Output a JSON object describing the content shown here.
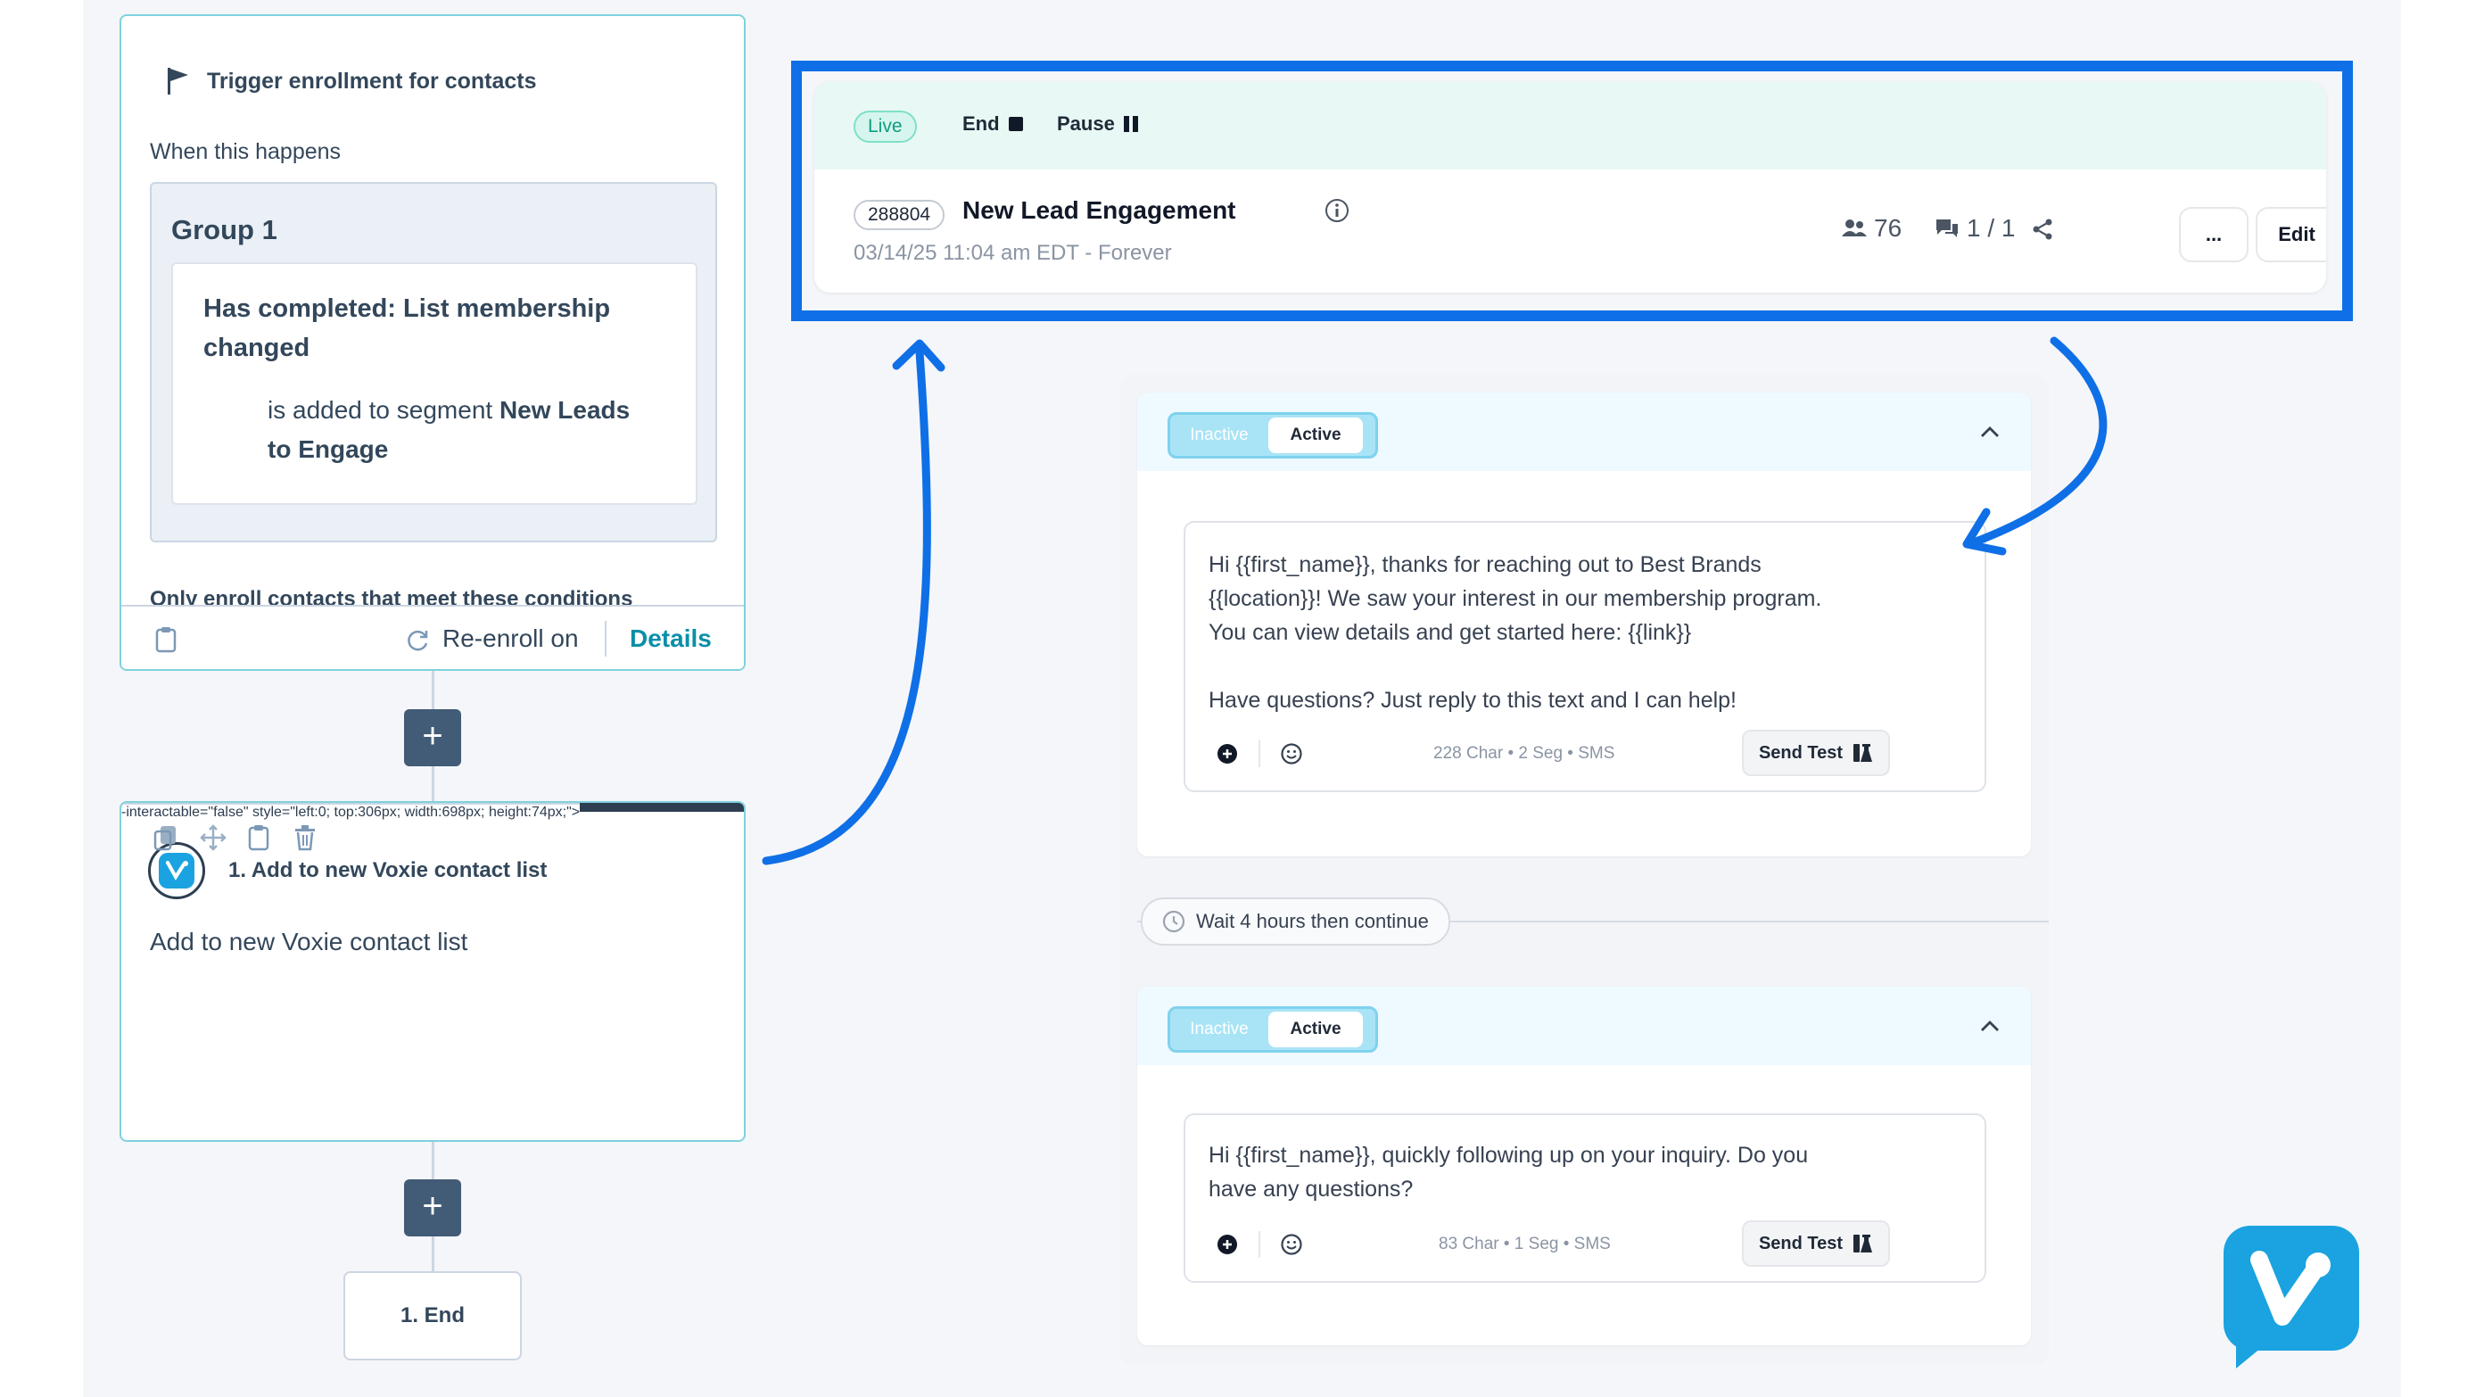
{
  "trigger": {
    "title": "Trigger enrollment for contacts",
    "when_label": "When this happens",
    "group_title": "Group 1",
    "condition_title_1": "Has completed: List membership",
    "condition_title_2": "changed",
    "condition_prefix": "is added to segment ",
    "condition_segment_1": "New Leads",
    "condition_segment_2": "to Engage",
    "only_enroll": "Only enroll contacts that meet these conditions",
    "reenroll": "Re-enroll on",
    "details": "Details"
  },
  "action": {
    "title": "1. Add to new Voxie contact list",
    "body": "Add to new Voxie contact list"
  },
  "end_label": "1. End",
  "plus_label": "+",
  "header": {
    "status_live": "Live",
    "end_label": "End",
    "pause_label": "Pause",
    "campaign_id": "288804",
    "campaign_name": "New Lead Engagement",
    "subtitle": "03/14/25 11:04 am EDT - Forever",
    "contacts_count": "76",
    "messages_ratio": "1 / 1",
    "more_label": "...",
    "edit_label": "Edit"
  },
  "steps": [
    {
      "toggle_off": "Inactive",
      "toggle_on": "Active",
      "message_lines": [
        "Hi {{first_name}}, thanks for reaching out to Best Brands",
        "{{location}}! We saw your interest in our membership program.",
        "You can view details and get started here: {{link}}",
        "",
        "Have questions? Just reply to this text and I can help!"
      ],
      "meta": "228 Char • 2 Seg • SMS",
      "send_test": "Send Test"
    },
    {
      "toggle_off": "Inactive",
      "toggle_on": "Active",
      "message_lines": [
        "Hi {{first_name}}, quickly following up on your inquiry. Do you",
        "have any questions?"
      ],
      "meta": "83 Char • 1 Seg • SMS",
      "send_test": "Send Test"
    }
  ],
  "wait_label": "Wait 4 hours then continue",
  "colors": {
    "highlight": "#0f6fe6",
    "arrow": "#0f6fe6",
    "logo": "#1aa3e0",
    "link": "#0b8fa8",
    "plus_button": "#425b76"
  }
}
